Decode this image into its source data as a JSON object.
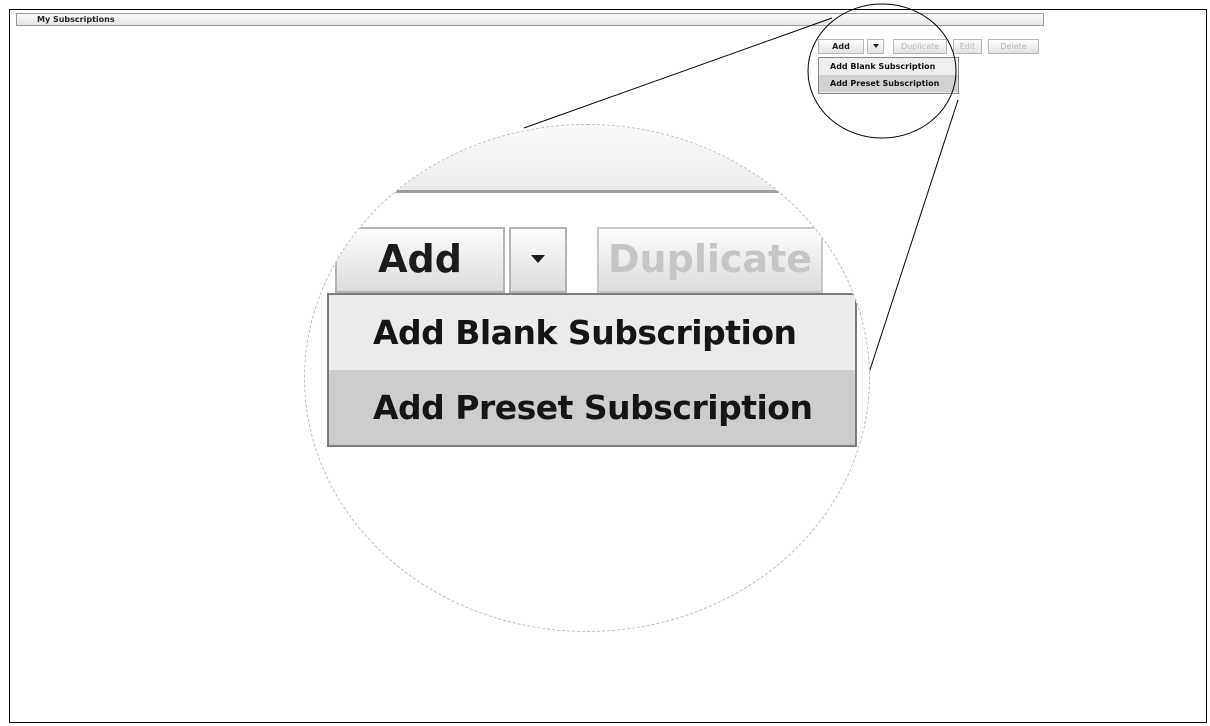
{
  "panel": {
    "title": "My Subscriptions"
  },
  "toolbar": {
    "add_label": "Add",
    "dropdown_caret": "caret-down-icon",
    "duplicate_label": "Duplicate",
    "edit_label": "Edit",
    "delete_label": "Delete"
  },
  "add_menu": {
    "items": [
      {
        "label": "Add Blank Subscription",
        "highlighted": false
      },
      {
        "label": "Add Preset Subscription",
        "highlighted": true
      }
    ]
  },
  "colors": {
    "menu_highlight": "#d2d2d2",
    "disabled_text": "#b5b5b5",
    "border": "#000000"
  }
}
